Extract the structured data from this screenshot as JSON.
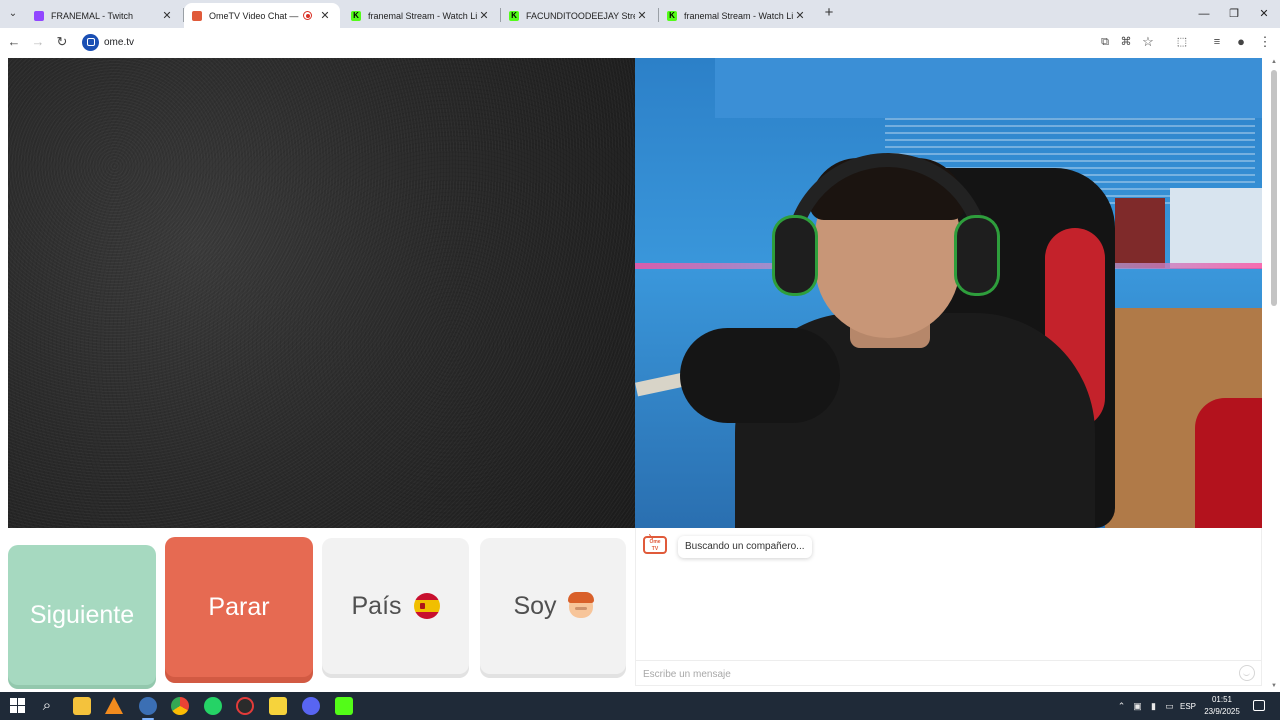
{
  "browser": {
    "tabs": [
      {
        "title": "FRANEMAL - Twitch",
        "favicon": "twitch-icon",
        "active": false
      },
      {
        "title": "OmeTV Video Chat — Ome",
        "favicon": "ometv-icon",
        "active": true,
        "recording": true
      },
      {
        "title": "franemal Stream - Watch Live o",
        "favicon": "kick-icon",
        "active": false
      },
      {
        "title": "FACUNDITOODEEJAY Stream - W",
        "favicon": "kick-icon",
        "active": false
      },
      {
        "title": "franemal Stream - Watch Live o",
        "favicon": "kick-icon",
        "active": false
      }
    ],
    "address": "ome.tv",
    "colors": {
      "twitch": "#9146ff",
      "kick": "#53fc18",
      "ometv": "#e05a3a"
    }
  },
  "controls": {
    "next_label": "Siguiente",
    "stop_label": "Parar",
    "country_label": "País",
    "country_flag": "spain-flag-icon",
    "gender_label": "Soy",
    "gender_icon": "boy-emoji-icon"
  },
  "chat": {
    "status": "Buscando un compañero...",
    "input_placeholder": "Escribe un mensaje"
  },
  "taskbar": {
    "language": "ESP",
    "time": "01:51",
    "date": "23/9/2025"
  }
}
